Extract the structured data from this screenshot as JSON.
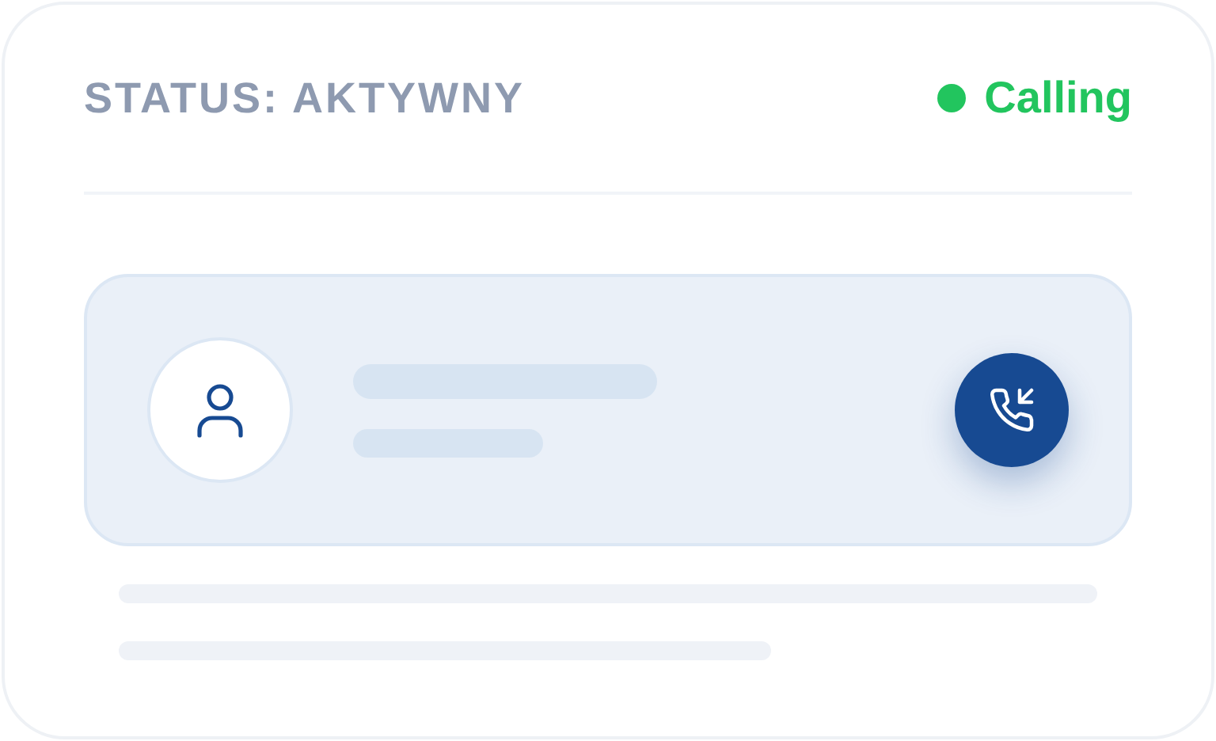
{
  "header": {
    "title": "STATUS: AKTYWNY",
    "status": {
      "label": "Calling",
      "color": "#22c55e"
    }
  }
}
